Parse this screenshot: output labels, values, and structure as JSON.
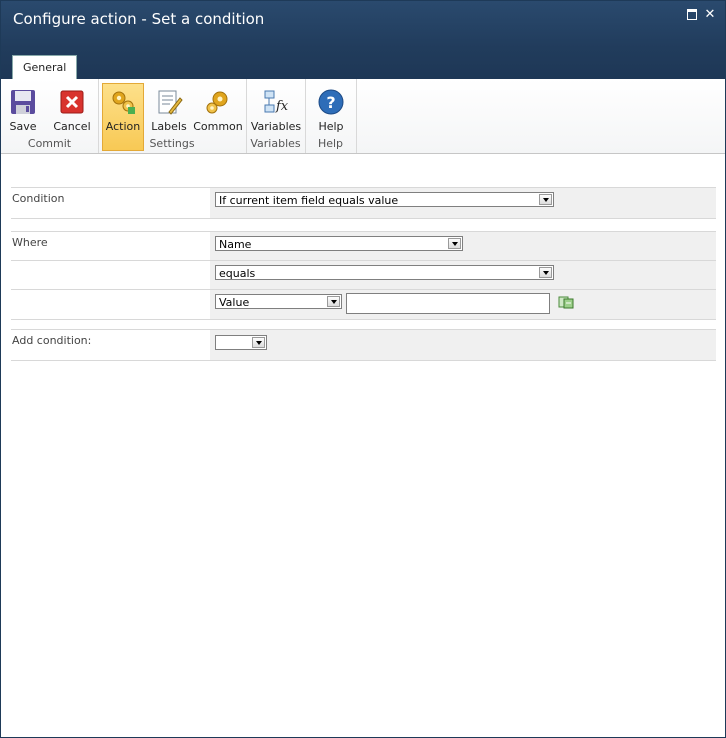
{
  "window": {
    "title": "Configure action - Set a condition"
  },
  "tabs": [
    {
      "label": "General"
    }
  ],
  "ribbon": {
    "commit": {
      "label": "Commit",
      "save": "Save",
      "cancel": "Cancel"
    },
    "settings": {
      "label": "Settings",
      "action": "Action",
      "labels": "Labels",
      "common": "Common"
    },
    "variables": {
      "label": "Variables",
      "variables": "Variables"
    },
    "help": {
      "label": "Help",
      "help": "Help"
    }
  },
  "form": {
    "condition": {
      "label": "Condition",
      "value": "If current item field equals value"
    },
    "where": {
      "label": "Where",
      "field": "Name",
      "operator": "equals",
      "value_type": "Value",
      "value_text": ""
    },
    "add_condition": {
      "label": "Add condition:",
      "value": ""
    }
  },
  "colors": {
    "titlebar": "#213c5c",
    "active_button": "#f8c955",
    "form_bg": "#f0f0f0"
  }
}
